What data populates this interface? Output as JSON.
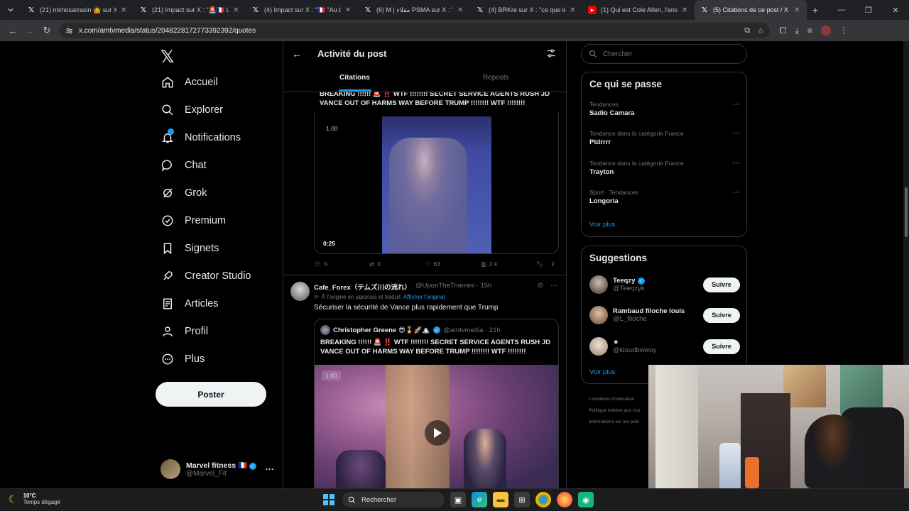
{
  "browser": {
    "tabs": [
      {
        "icon": "x-logo-icon",
        "title": "(21) mimosarrasin 🤷 sur X : \"C"
      },
      {
        "icon": "x-logo-icon",
        "title": "(21) Impact sur X : \"🚨🇫🇷 LE RAS"
      },
      {
        "icon": "x-logo-icon",
        "title": "(4) Impact sur X : \"🇫🇷 \"Au bout"
      },
      {
        "icon": "x-logo-icon",
        "title": "(6) M | مقلاء PSMA sur X : \"Mais c"
      },
      {
        "icon": "x-logo-icon",
        "title": "(4) BRKre sur X : \"ce que le man"
      },
      {
        "icon": "youtube-icon",
        "title": "(1) Qui est Cole Allen, l'enseign"
      },
      {
        "icon": "x-logo-icon",
        "title": "(5) Citations de ce post / X"
      }
    ],
    "active_tab": 6,
    "url": "x.com/amtvmedia/status/2048228172773392392/quotes"
  },
  "nav": {
    "items": [
      {
        "label": "Accueil",
        "icon": "home-icon"
      },
      {
        "label": "Explorer",
        "icon": "search-icon"
      },
      {
        "label": "Notifications",
        "icon": "bell-icon"
      },
      {
        "label": "Chat",
        "icon": "chat-icon"
      },
      {
        "label": "Grok",
        "icon": "grok-icon"
      },
      {
        "label": "Premium",
        "icon": "premium-icon"
      },
      {
        "label": "Signets",
        "icon": "bookmark-icon"
      },
      {
        "label": "Creator Studio",
        "icon": "rocket-icon"
      },
      {
        "label": "Articles",
        "icon": "article-icon"
      },
      {
        "label": "Profil",
        "icon": "profile-icon"
      },
      {
        "label": "Plus",
        "icon": "more-circle-icon"
      }
    ],
    "post_button": "Poster",
    "account": {
      "name": "Marvel fitness 🇫🇷",
      "handle": "@Marvel_Fit"
    }
  },
  "center": {
    "title": "Activité du post",
    "tabs": [
      "Citations",
      "Reposts"
    ],
    "first_post": {
      "text": "BREAKING !!!!!! 🚨 ‼️ WTF !!!!!!!! SECRET SERVICE AGENTS RUSH JD VANCE OUT OF HARMS WAY BEFORE TRUMP !!!!!!!! WTF !!!!!!!!",
      "speed": "1.00",
      "duration": "0:25",
      "replies": "5",
      "reposts": "3",
      "likes": "63",
      "views": "2 k"
    },
    "second_post": {
      "name": "Cafe_Forex（テムズ川の流れ）",
      "handle": "@UponTheThames · 15h",
      "translation_note": "À l'origine en japonais et traduit",
      "translation_link": "Afficher l'original",
      "text": "Sécuriser la sécurité de Vance plus rapidement que Trump",
      "quote": {
        "name": "Christopher Greene 😎🎖️🚀🏔️",
        "handle": "@amtvmedia · 21h",
        "text": "BREAKING !!!!!! 🚨 ‼️ WTF !!!!!!!! SECRET SERVICE AGENTS RUSH JD VANCE OUT OF HARMS WAY BEFORE TRUMP !!!!!!!! WTF !!!!!!!!",
        "speed": "1.00"
      }
    }
  },
  "right": {
    "search_placeholder": "Chercher",
    "trends_title": "Ce qui se passe",
    "trends": [
      {
        "context": "Tendances",
        "name": "Sadio Camara"
      },
      {
        "context": "Tendance dans la catégorie France",
        "name": "Ptdrrrr"
      },
      {
        "context": "Tendance dans la catégorie France",
        "name": "Trayton"
      },
      {
        "context": "Sport · Tendances",
        "name": "Longoria"
      }
    ],
    "see_more": "Voir plus",
    "suggestions_title": "Suggestions",
    "suggestions": [
      {
        "name": "Teeqzy",
        "handle": "@Teeqzyk",
        "verified": true,
        "button": "Suivre"
      },
      {
        "name": "Rambaud filoche louis",
        "handle": "@L_filoche",
        "verified": false,
        "button": "Suivre"
      },
      {
        "name": "★",
        "handle": "@kloudbwwoy",
        "verified": false,
        "button": "Suivre"
      }
    ],
    "footer": [
      "Conditions d'utilisation",
      "Politique relative aux coo",
      "Informations sur les publ"
    ]
  },
  "taskbar": {
    "temperature": "10°C",
    "weather": "Temps dégagé",
    "search": "Rechercher"
  },
  "colors": {
    "accent": "#1d9bf0",
    "background": "#000000",
    "text_primary": "#e7e9ea",
    "text_secondary": "#71767b",
    "border": "#2f3336"
  }
}
